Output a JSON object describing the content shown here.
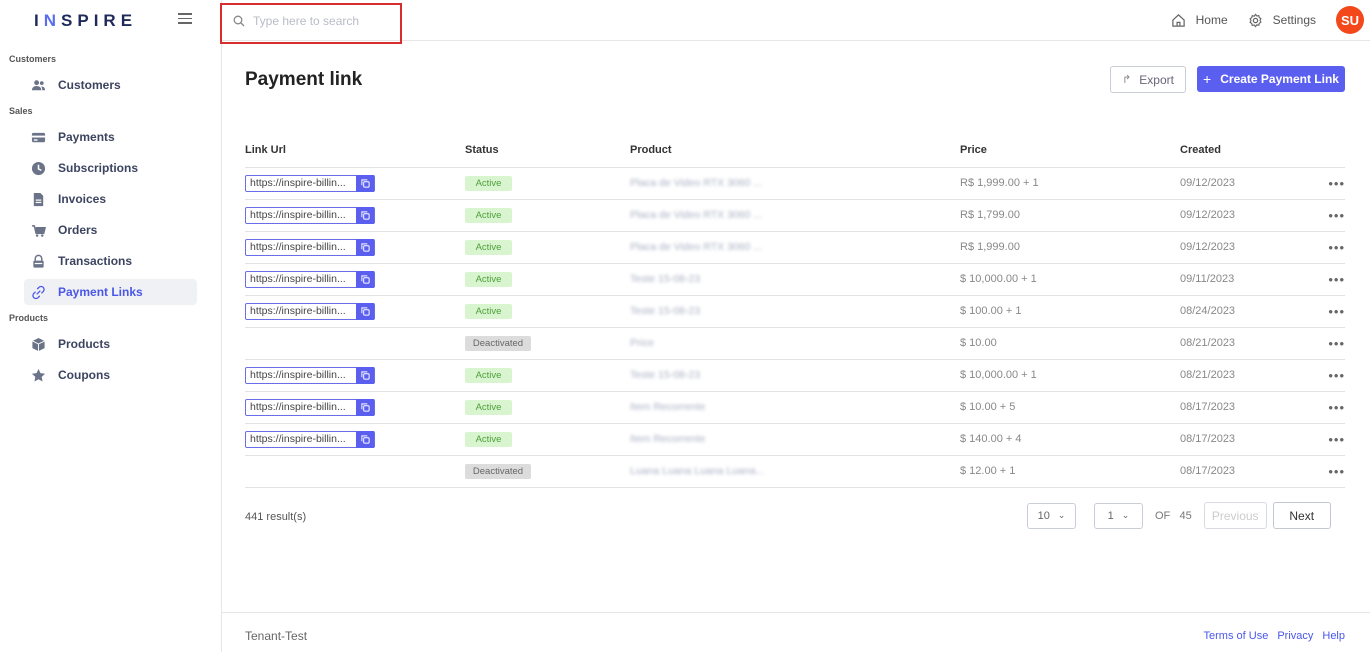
{
  "logo": {
    "pre": "I",
    "n": "N",
    "post": "SPIRE"
  },
  "sidebar": {
    "sections": [
      {
        "label": "Customers"
      },
      {
        "label": "Sales"
      },
      {
        "label": "Products"
      }
    ],
    "items": [
      {
        "label": "Customers",
        "icon": "users-icon"
      },
      {
        "label": "Payments",
        "icon": "card-icon"
      },
      {
        "label": "Subscriptions",
        "icon": "clock-icon"
      },
      {
        "label": "Invoices",
        "icon": "file-icon"
      },
      {
        "label": "Orders",
        "icon": "cart-icon"
      },
      {
        "label": "Transactions",
        "icon": "lock-icon"
      },
      {
        "label": "Payment Links",
        "icon": "link-icon"
      },
      {
        "label": "Products",
        "icon": "box-icon"
      },
      {
        "label": "Coupons",
        "icon": "star-icon"
      }
    ]
  },
  "search": {
    "placeholder": "Type here to search"
  },
  "topbar": {
    "home": "Home",
    "settings": "Settings",
    "avatar": "SU"
  },
  "page": {
    "title": "Payment link",
    "export": "Export",
    "create": "Create Payment Link"
  },
  "table": {
    "headers": [
      "Link Url",
      "Status",
      "Product",
      "Price",
      "Created"
    ],
    "rows": [
      {
        "link": "https://inspire-billin...",
        "status": "Active",
        "product": "Placa de Video RTX 3060 ...",
        "price": "R$ 1,999.00 + 1",
        "created": "09/12/2023"
      },
      {
        "link": "https://inspire-billin...",
        "status": "Active",
        "product": "Placa de Video RTX 3060 ...",
        "price": "R$ 1,799.00",
        "created": "09/12/2023"
      },
      {
        "link": "https://inspire-billin...",
        "status": "Active",
        "product": "Placa de Video RTX 3060 ...",
        "price": "R$ 1,999.00",
        "created": "09/12/2023"
      },
      {
        "link": "https://inspire-billin...",
        "status": "Active",
        "product": "Teste 15-08-23",
        "price": "$ 10,000.00 + 1",
        "created": "09/11/2023"
      },
      {
        "link": "https://inspire-billin...",
        "status": "Active",
        "product": "Teste 15-08-23",
        "price": "$ 100.00 + 1",
        "created": "08/24/2023"
      },
      {
        "link": "",
        "status": "Deactivated",
        "product": "Price",
        "price": "$ 10.00",
        "created": "08/21/2023"
      },
      {
        "link": "https://inspire-billin...",
        "status": "Active",
        "product": "Teste 15-08-23",
        "price": "$ 10,000.00 + 1",
        "created": "08/21/2023"
      },
      {
        "link": "https://inspire-billin...",
        "status": "Active",
        "product": "Item Recorrente",
        "price": "$ 10.00 + 5",
        "created": "08/17/2023"
      },
      {
        "link": "https://inspire-billin...",
        "status": "Active",
        "product": "Item Recorrente",
        "price": "$ 140.00 + 4",
        "created": "08/17/2023"
      },
      {
        "link": "",
        "status": "Deactivated",
        "product": "Luana Luana Luana Luana...",
        "price": "$ 12.00 + 1",
        "created": "08/17/2023"
      }
    ]
  },
  "pagination": {
    "results": "441 result(s)",
    "page_size": "10",
    "page": "1",
    "of": "OF",
    "total_pages": "45",
    "prev": "Previous",
    "next": "Next"
  },
  "footer": {
    "tenant": "Tenant-Test",
    "terms": "Terms of Use",
    "privacy": "Privacy",
    "help": "Help"
  }
}
